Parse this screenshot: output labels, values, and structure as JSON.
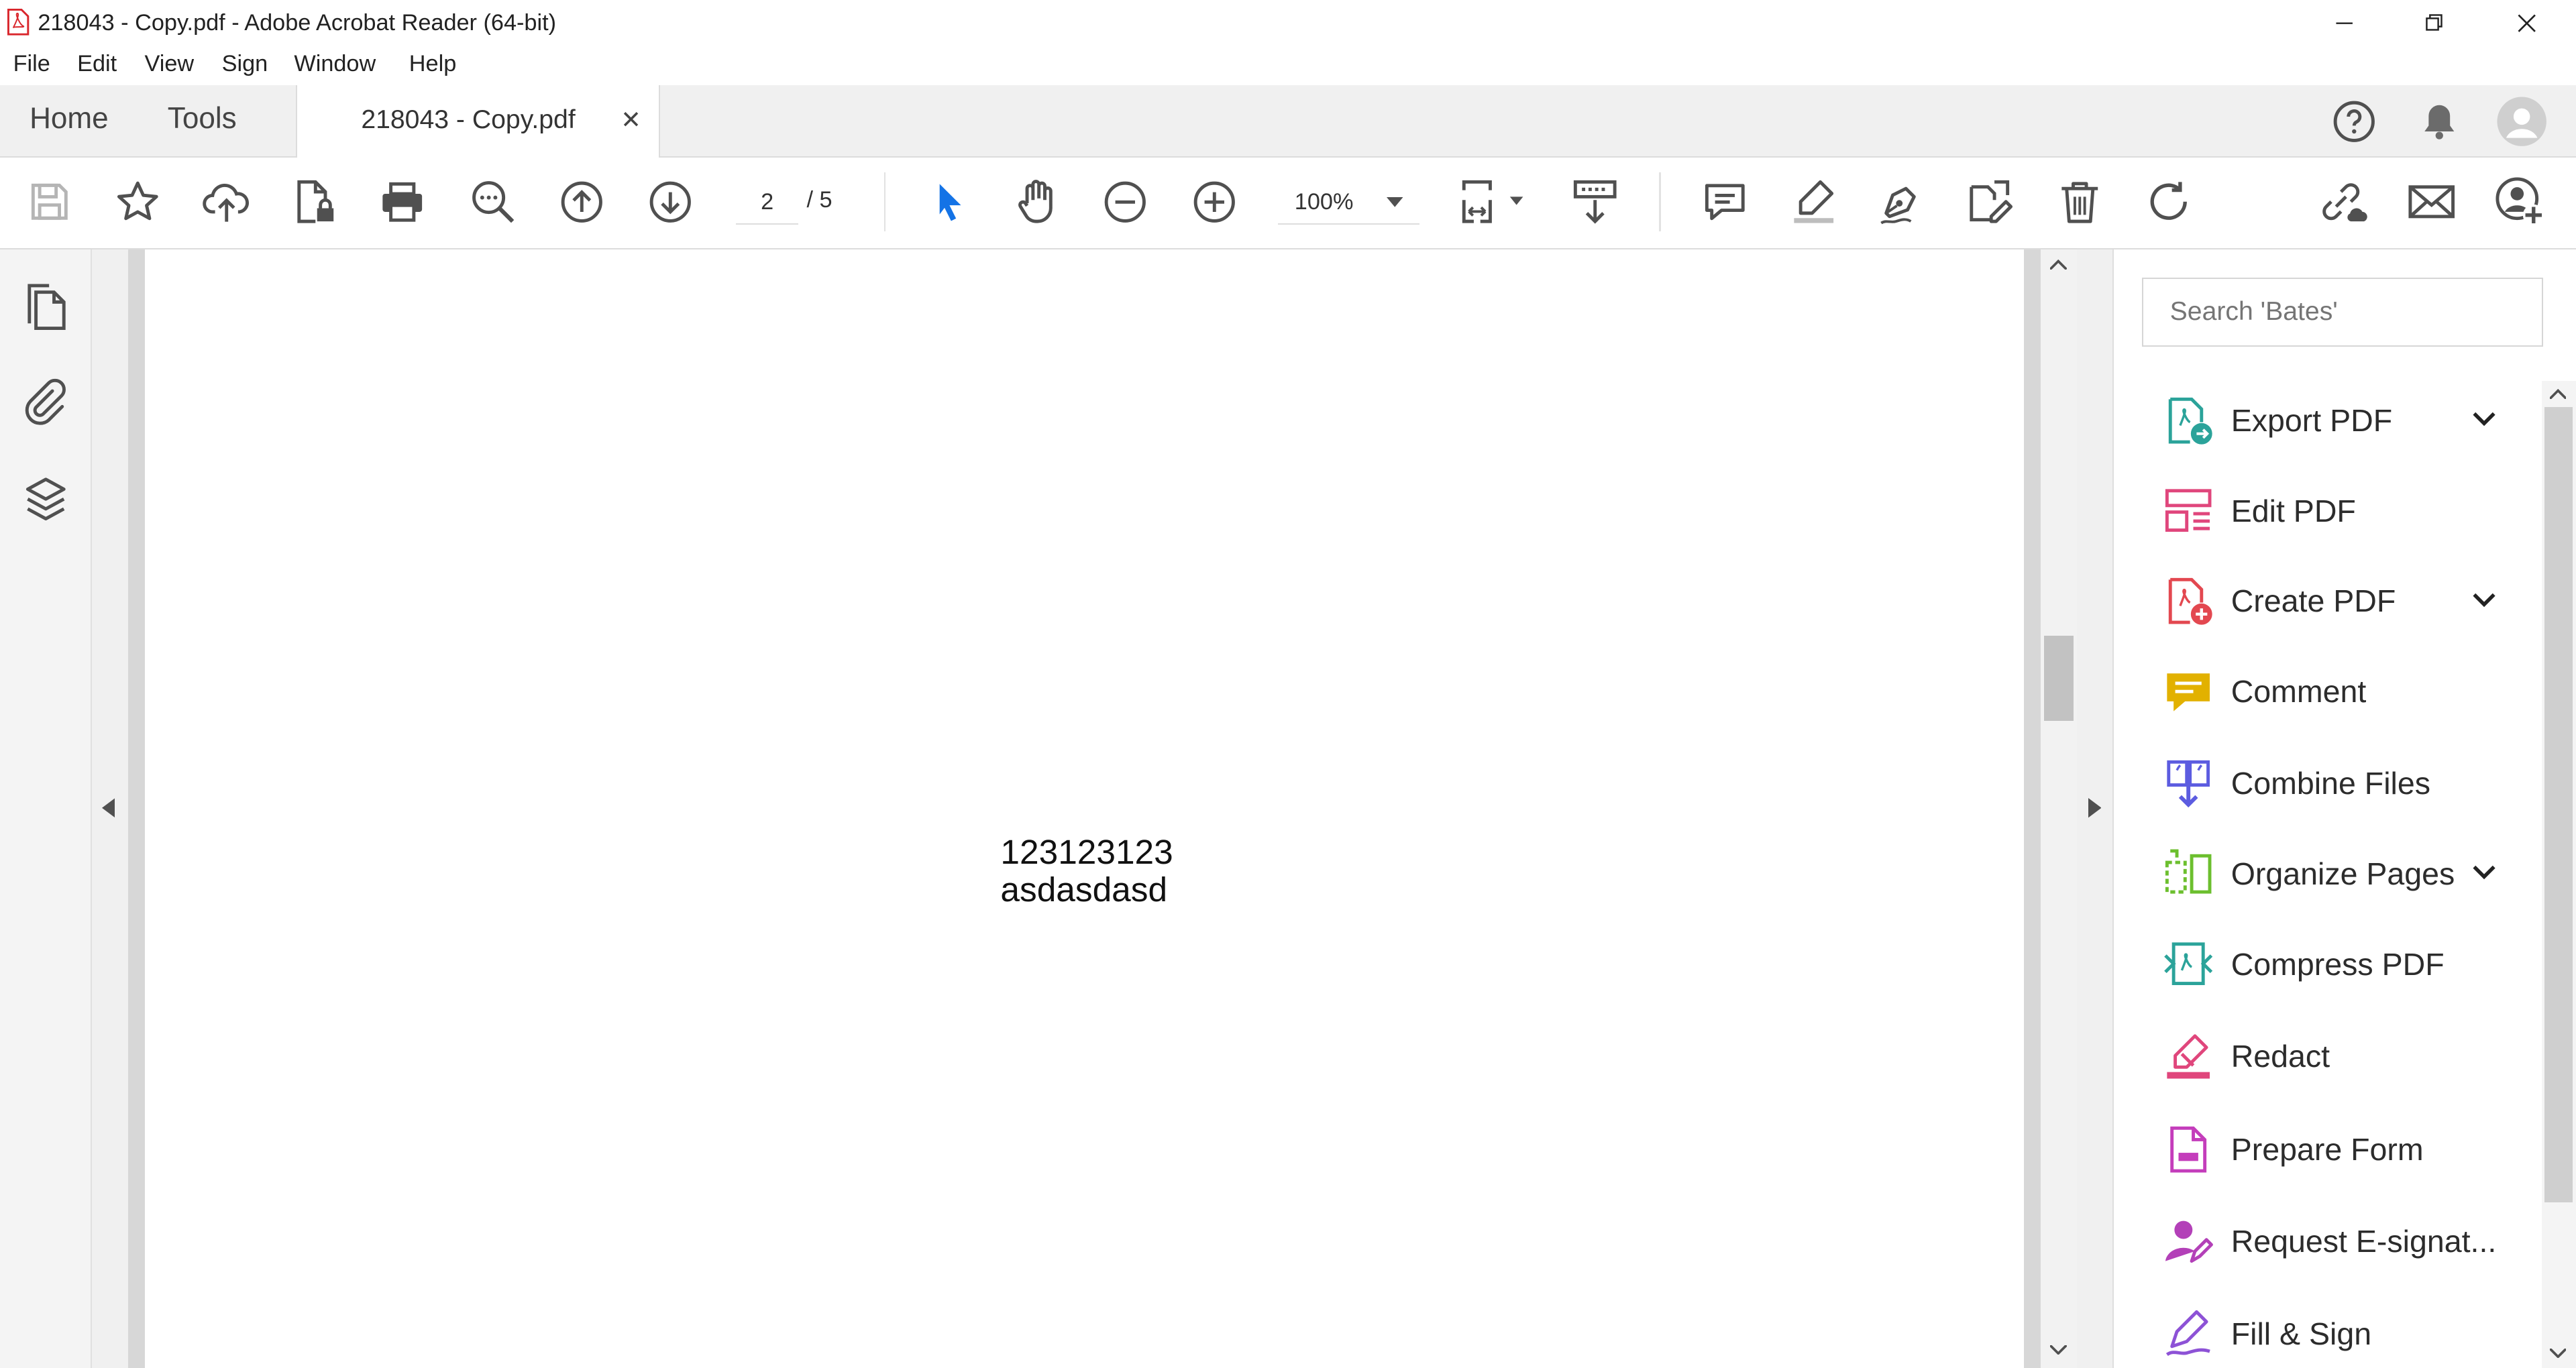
{
  "window": {
    "title": "218043 - Copy.pdf - Adobe Acrobat Reader (64-bit)"
  },
  "menu": [
    "File",
    "Edit",
    "View",
    "Sign",
    "Window",
    "Help"
  ],
  "tabs": {
    "home": "Home",
    "tools": "Tools",
    "document": "218043 - Copy.pdf"
  },
  "toolbar": {
    "current_page": "2",
    "page_total": "/ 5",
    "zoom": "100%"
  },
  "document": {
    "line1": "123123123",
    "line2": "asdasdasd"
  },
  "right_pane": {
    "search_placeholder": "Search 'Bates'",
    "tools": [
      {
        "label": "Export PDF",
        "color": "#2ba39a",
        "expandable": true
      },
      {
        "label": "Edit PDF",
        "color": "#e0467c",
        "expandable": false
      },
      {
        "label": "Create PDF",
        "color": "#e34850",
        "expandable": true
      },
      {
        "label": "Comment",
        "color": "#e2b100",
        "expandable": false
      },
      {
        "label": "Combine Files",
        "color": "#5c5ce0",
        "expandable": false
      },
      {
        "label": "Organize Pages",
        "color": "#6cbf2e",
        "expandable": true
      },
      {
        "label": "Compress PDF",
        "color": "#2ba39a",
        "expandable": false
      },
      {
        "label": "Redact",
        "color": "#e0467c",
        "expandable": false
      },
      {
        "label": "Prepare Form",
        "color": "#c43dbb",
        "expandable": false
      },
      {
        "label": "Request E-signat...",
        "color": "#b340b8",
        "expandable": false
      },
      {
        "label": "Fill & Sign",
        "color": "#8d52d6",
        "expandable": false
      }
    ]
  },
  "colors": {
    "accent_blue": "#1473e6",
    "icon_gray": "#505050"
  }
}
